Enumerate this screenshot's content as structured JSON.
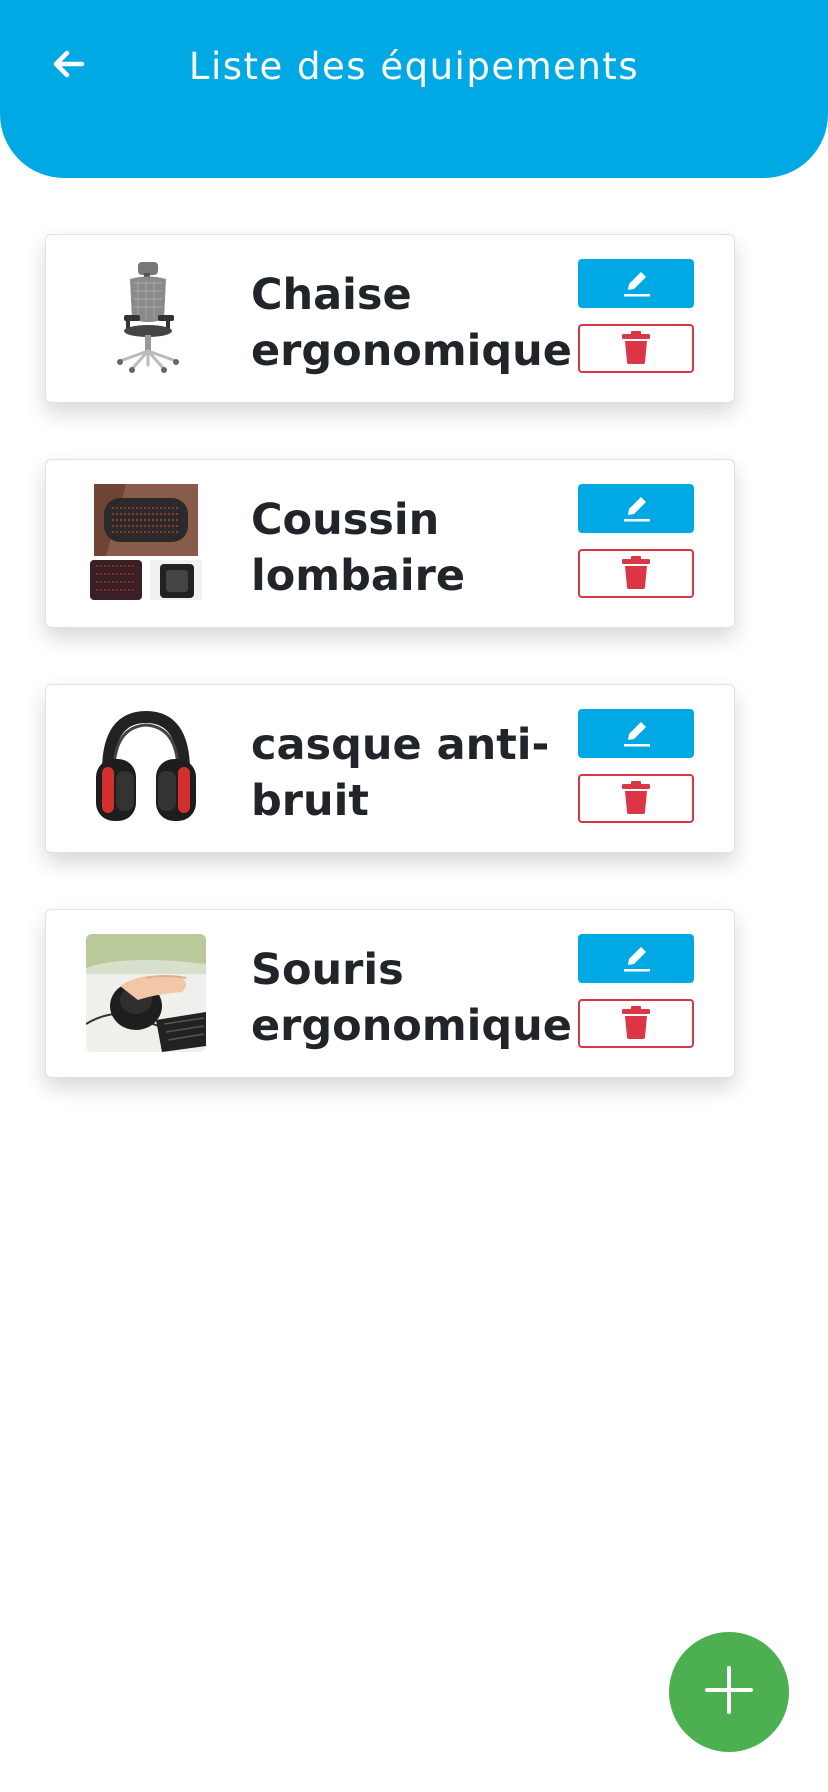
{
  "header": {
    "title": "Liste des équipements",
    "back_icon": "arrow-left-icon",
    "background_color": "#00a9e4"
  },
  "equipments": [
    {
      "name": "Chaise ergonomique",
      "image": "office-chair-image",
      "edit_icon": "pencil-icon",
      "delete_icon": "trash-icon"
    },
    {
      "name": "Coussin lombaire",
      "image": "lumbar-cushion-image",
      "edit_icon": "pencil-icon",
      "delete_icon": "trash-icon"
    },
    {
      "name": "casque anti-bruit",
      "image": "earmuffs-image",
      "edit_icon": "pencil-icon",
      "delete_icon": "trash-icon"
    },
    {
      "name": "Souris ergonomique",
      "image": "vertical-mouse-image",
      "edit_icon": "pencil-icon",
      "delete_icon": "trash-icon"
    }
  ],
  "fab": {
    "icon": "plus-icon",
    "color": "#4caf50"
  },
  "colors": {
    "edit": "#00a9e4",
    "delete": "#dc3545"
  }
}
